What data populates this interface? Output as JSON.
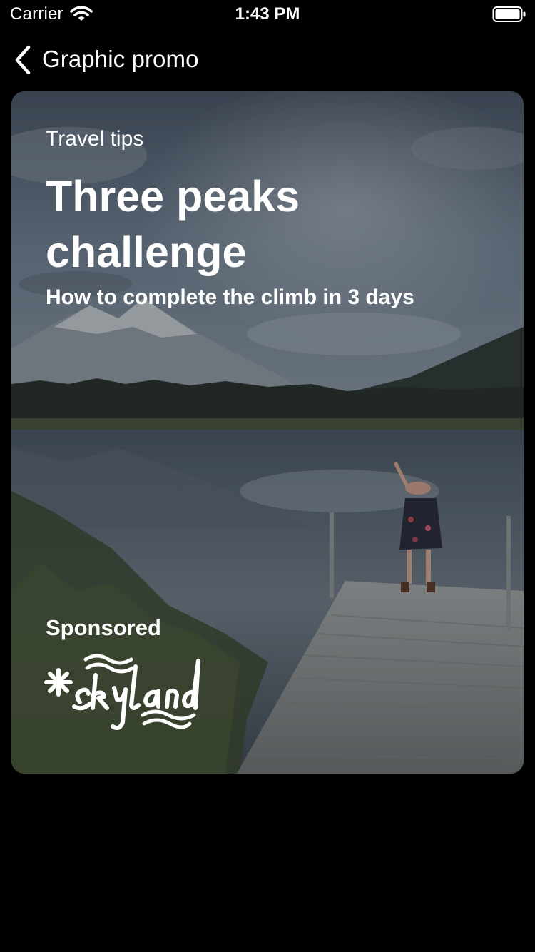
{
  "status_bar": {
    "carrier": "Carrier",
    "time": "1:43 PM",
    "wifi_icon": "wifi-icon",
    "battery_icon": "battery-icon"
  },
  "nav": {
    "back_icon": "chevron-left-icon",
    "title": "Graphic promo"
  },
  "promo": {
    "eyebrow": "Travel tips",
    "headline": "Three peaks challenge",
    "subhead": "How to complete the climb in 3 days",
    "sponsored_label": "Sponsored",
    "brand_logo_text": "skyland",
    "background_image": "mountain lake with wooden dock"
  },
  "colors": {
    "background": "#000000",
    "text": "#ffffff"
  }
}
